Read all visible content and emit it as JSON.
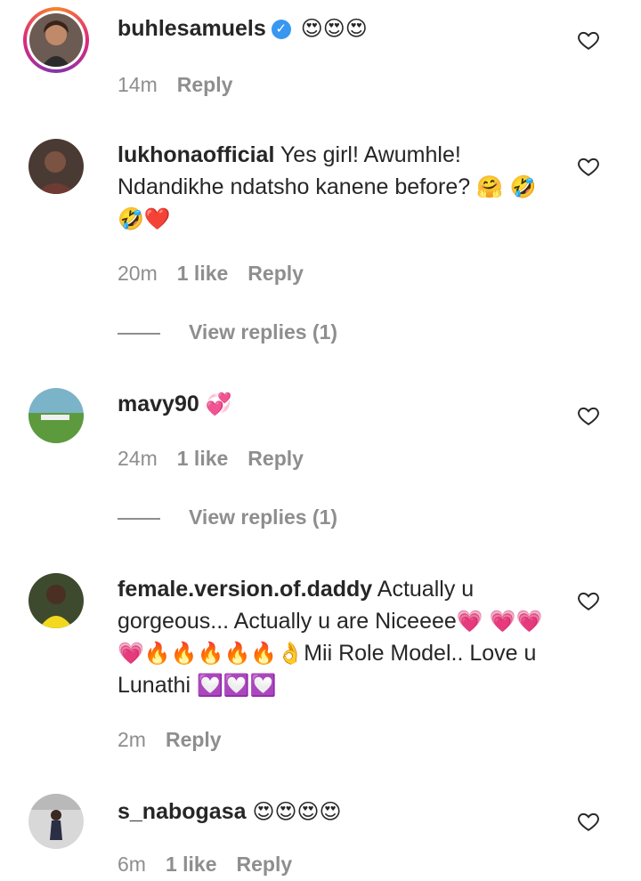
{
  "comments": [
    {
      "username": "buhlesamuels",
      "verified": true,
      "text": "",
      "emojis": "😍😍😍",
      "time": "14m",
      "likes": "",
      "reply": "Reply"
    },
    {
      "username": "lukhonaofficial",
      "text": "Yes girl! Awumhle! Ndandikhe ndatsho kanene before?",
      "emojis": "🤗 🤣🤣❤️",
      "time": "20m",
      "likes": "1 like",
      "reply": "Reply",
      "view_replies": "View replies (1)"
    },
    {
      "username": "mavy90",
      "text": "",
      "emojis": "💞",
      "time": "24m",
      "likes": "1 like",
      "reply": "Reply",
      "view_replies": "View replies (1)"
    },
    {
      "username": "female.version.of.daddy",
      "text_part1": "Actually u gorgeous... Actually u are Niceeee",
      "emojis_part1": "💗",
      "emojis_part2": "💗💗💗🔥🔥🔥🔥🔥👌",
      "text_part2": "Mii Role Model.. Love u Lunathi",
      "emojis_part3": "💟💟💟",
      "time": "2m",
      "likes": "",
      "reply": "Reply"
    },
    {
      "username": "s_nabogasa",
      "text": "",
      "emojis": "😍😍😍😍",
      "time": "6m",
      "likes": "1 like",
      "reply": "Reply"
    }
  ],
  "icons": {
    "like": "heart-outline-icon",
    "verified": "verified-badge-icon"
  },
  "colors": {
    "text": "#262626",
    "muted": "#8e8e8e",
    "verified": "#3897f0"
  }
}
